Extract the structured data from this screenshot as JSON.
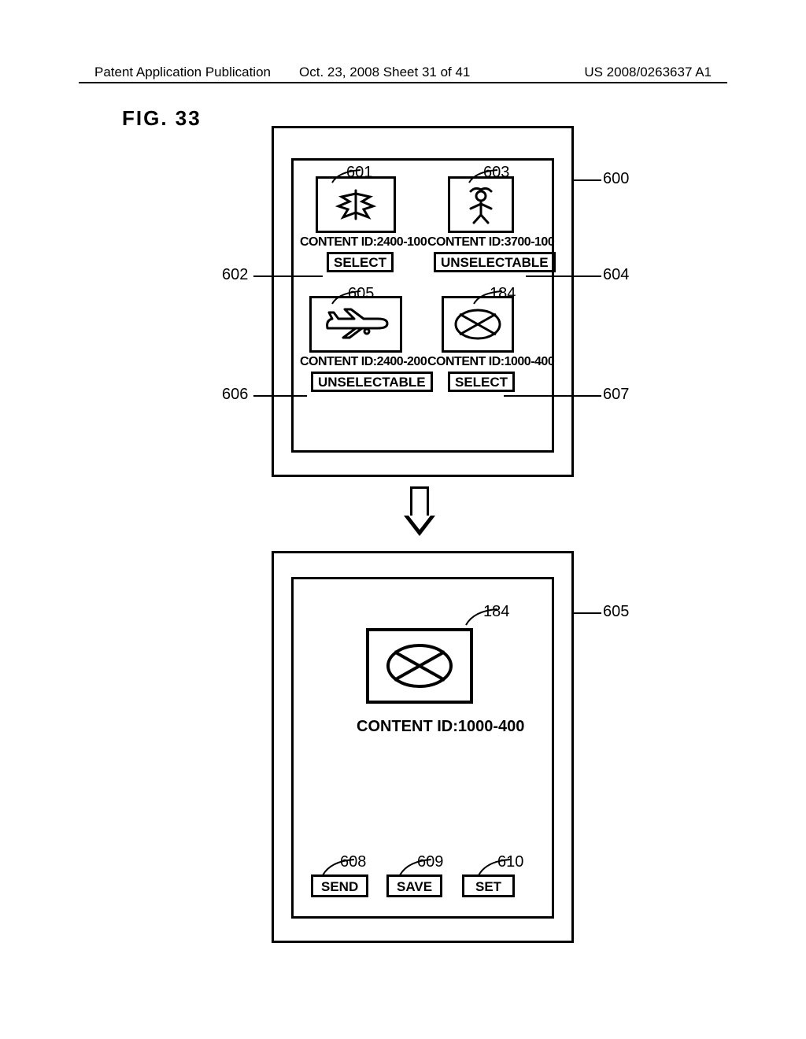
{
  "header": {
    "left": "Patent Application Publication",
    "mid": "Oct. 23, 2008  Sheet 31 of 41",
    "right": "US 2008/0263637 A1"
  },
  "figure_label": "FIG. 33",
  "screen1": {
    "items": [
      {
        "content_id": "CONTENT ID:2400-100",
        "button": "SELECT",
        "icon": "leaf",
        "ref_thumb": "601",
        "ref_btn": "602"
      },
      {
        "content_id": "CONTENT ID:3700-100",
        "button": "UNSELECTABLE",
        "icon": "person",
        "ref_thumb": "603",
        "ref_btn": "604"
      },
      {
        "content_id": "CONTENT ID:2400-200",
        "button": "UNSELECTABLE",
        "icon": "airplane",
        "ref_thumb": "605",
        "ref_btn": "606"
      },
      {
        "content_id": "CONTENT ID:1000-400",
        "button": "SELECT",
        "icon": "ellipse-x",
        "ref_thumb": "184",
        "ref_btn": "607"
      }
    ],
    "ref_panel": "600"
  },
  "screen2": {
    "content_id": "CONTENT ID:1000-400",
    "icon": "ellipse-x",
    "ref_thumb": "184",
    "ref_panel": "605",
    "buttons": [
      {
        "label": "SEND",
        "ref": "608"
      },
      {
        "label": "SAVE",
        "ref": "609"
      },
      {
        "label": "SET",
        "ref": "610"
      }
    ]
  }
}
